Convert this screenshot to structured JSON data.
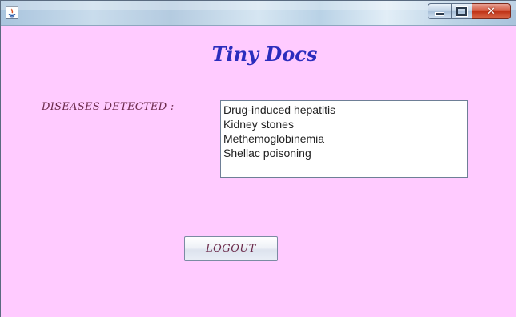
{
  "window": {
    "title": "",
    "icon": "java-app-icon",
    "controls": {
      "minimize": "minimize-icon",
      "maximize": "maximize-icon",
      "close": "close-icon",
      "close_glyph": "✕"
    }
  },
  "main": {
    "title": "Tiny Docs",
    "diseases_label": "DISEASES DETECTED :",
    "diseases": [
      "Drug-induced hepatitis",
      "Kidney stones",
      "Methemoglobinemia",
      "Shellac poisoning"
    ],
    "logout_label": "LOGOUT"
  },
  "colors": {
    "background": "#ffcbff",
    "title": "#2b2dbd",
    "label": "#6b2a4a"
  }
}
